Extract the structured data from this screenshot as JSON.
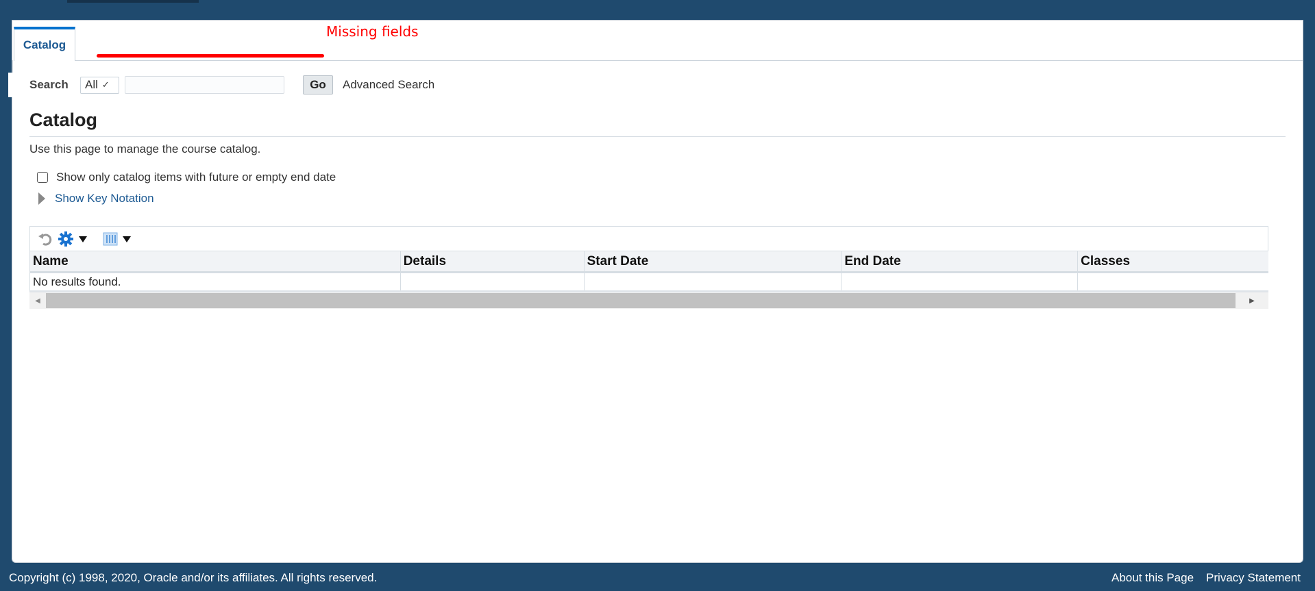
{
  "tabs": [
    {
      "label": "Catalog",
      "active": true
    }
  ],
  "annotation": {
    "text": "Missing fields",
    "color": "#ff0000"
  },
  "search": {
    "label": "Search",
    "scope": "All",
    "value": "",
    "go_label": "Go",
    "advanced_label": "Advanced Search"
  },
  "page": {
    "title": "Catalog",
    "description": "Use this page to manage the course catalog.",
    "checkbox_label": "Show only catalog items with future or empty end date",
    "checkbox_checked": false,
    "key_notation_label": "Show Key Notation"
  },
  "table": {
    "toolbar_icons": [
      "refresh-icon",
      "gear-icon",
      "columns-icon"
    ],
    "columns": [
      "Name",
      "Details",
      "Start Date",
      "End Date",
      "Classes"
    ],
    "empty_message": "No results found."
  },
  "footer": {
    "copyright": "Copyright (c) 1998, 2020, Oracle and/or its affiliates. All rights reserved.",
    "links": [
      "About this Page",
      "Privacy Statement"
    ]
  },
  "colors": {
    "background": "#1f4a6e",
    "accent": "#0572ce",
    "link": "#1d5a93"
  }
}
